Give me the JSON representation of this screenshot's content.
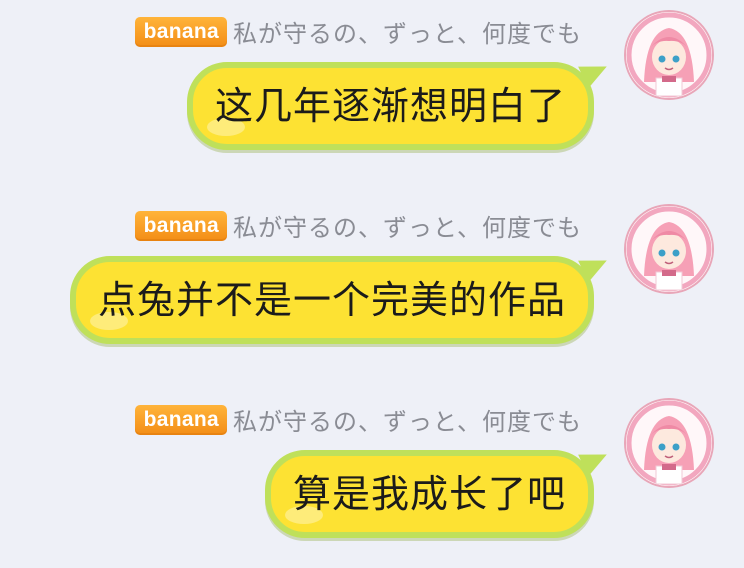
{
  "sender": {
    "badge": "banana",
    "name": "私が守るの、ずっと、何度でも"
  },
  "messages": [
    {
      "text": "这几年逐渐想明白了"
    },
    {
      "text": "点兔并不是一个完美的作品"
    },
    {
      "text": "算是我成长了吧"
    }
  ],
  "colors": {
    "background": "#eef0f7",
    "bubble_fill": "#fde233",
    "bubble_border": "#bfe05a",
    "badge": "#f7a024",
    "name_text": "#8a8c94"
  }
}
